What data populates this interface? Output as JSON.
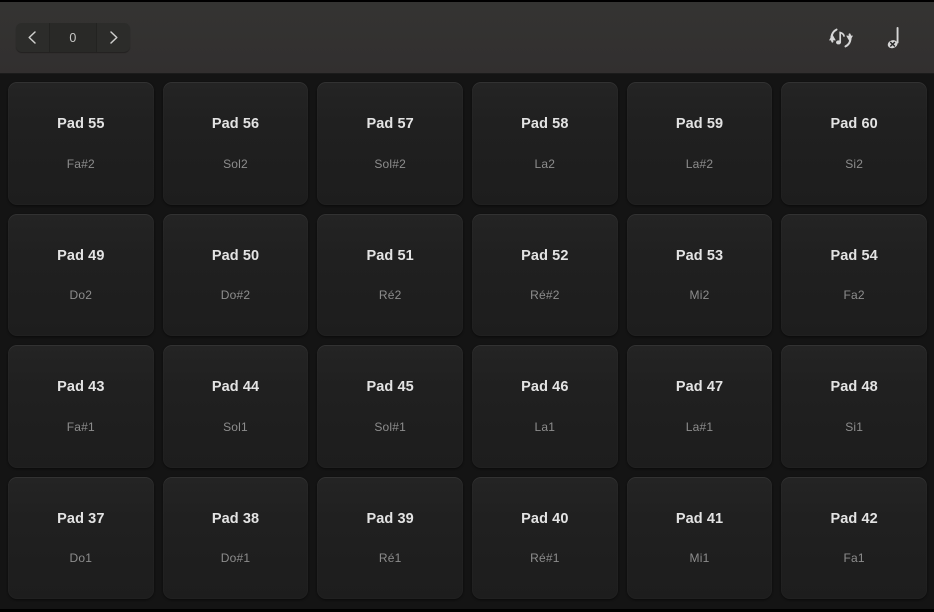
{
  "toolbar": {
    "stepper": {
      "prev_label": "chevron-left",
      "value": "0",
      "next_label": "chevron-right"
    },
    "icons": [
      {
        "name": "note-repeat-icon",
        "title": "Note Repeat"
      },
      {
        "name": "note-off-icon",
        "title": "Note Off"
      }
    ]
  },
  "colors": {
    "toolbar_bg": "#322f2f",
    "grid_bg": "#141414",
    "pad_bg": "#212121",
    "pad_label": "#e3e3e3",
    "pad_note": "#8d8d8d"
  },
  "pads": [
    {
      "name": "Pad 55",
      "note": "Fa#2"
    },
    {
      "name": "Pad 56",
      "note": "Sol2"
    },
    {
      "name": "Pad 57",
      "note": "Sol#2"
    },
    {
      "name": "Pad 58",
      "note": "La2"
    },
    {
      "name": "Pad 59",
      "note": "La#2"
    },
    {
      "name": "Pad 60",
      "note": "Si2"
    },
    {
      "name": "Pad 49",
      "note": "Do2"
    },
    {
      "name": "Pad 50",
      "note": "Do#2"
    },
    {
      "name": "Pad 51",
      "note": "Ré2"
    },
    {
      "name": "Pad 52",
      "note": "Ré#2"
    },
    {
      "name": "Pad 53",
      "note": "Mi2"
    },
    {
      "name": "Pad 54",
      "note": "Fa2"
    },
    {
      "name": "Pad 43",
      "note": "Fa#1"
    },
    {
      "name": "Pad 44",
      "note": "Sol1"
    },
    {
      "name": "Pad 45",
      "note": "Sol#1"
    },
    {
      "name": "Pad 46",
      "note": "La1"
    },
    {
      "name": "Pad 47",
      "note": "La#1"
    },
    {
      "name": "Pad 48",
      "note": "Si1"
    },
    {
      "name": "Pad 37",
      "note": "Do1"
    },
    {
      "name": "Pad 38",
      "note": "Do#1"
    },
    {
      "name": "Pad 39",
      "note": "Ré1"
    },
    {
      "name": "Pad 40",
      "note": "Ré#1"
    },
    {
      "name": "Pad 41",
      "note": "Mi1"
    },
    {
      "name": "Pad 42",
      "note": "Fa1"
    }
  ]
}
